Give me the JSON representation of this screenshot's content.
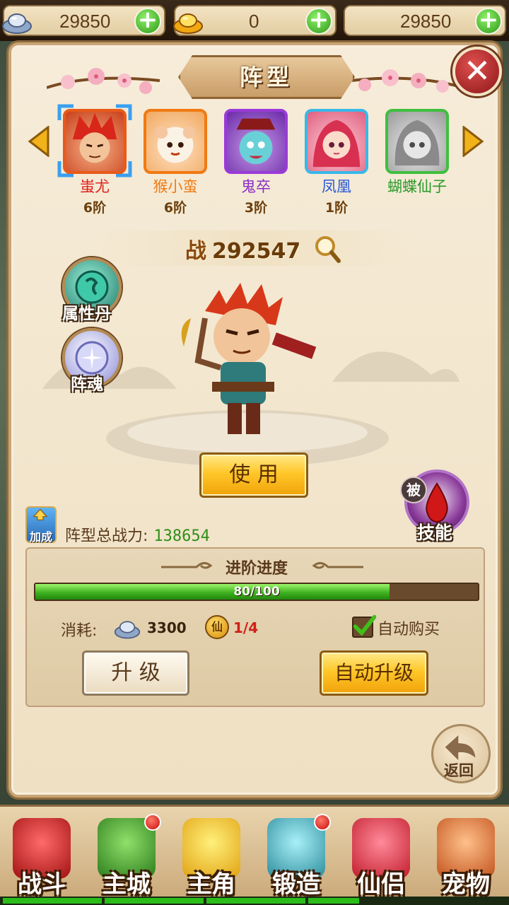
{
  "currency": {
    "silver": "29850",
    "gold": "0",
    "third": "29850",
    "plus": "+"
  },
  "panel": {
    "title": "阵型",
    "close": "✕"
  },
  "heroes": [
    {
      "name": "蚩尤",
      "rank": "6阶",
      "name_color": "#e0201a",
      "frame_color": "#e85a1a",
      "selected": true
    },
    {
      "name": "猴小蛮",
      "rank": "6阶",
      "name_color": "#f07a12",
      "frame_color": "#f07a12",
      "selected": false
    },
    {
      "name": "鬼卒",
      "rank": "3阶",
      "name_color": "#8a2cc8",
      "frame_color": "#9a3ad8",
      "selected": false
    },
    {
      "name": "凤凰",
      "rank": "1阶",
      "name_color": "#2a5ad8",
      "frame_color": "#38b8e8",
      "selected": false
    },
    {
      "name": "蝴蝶仙子",
      "rank": "",
      "name_color": "#2a9a2a",
      "frame_color": "#3fbf3f",
      "selected": false
    }
  ],
  "combat": {
    "label": "战",
    "value": "292547"
  },
  "side_buttons": {
    "attribute_pill": "属性丹",
    "formation_soul": "阵魂"
  },
  "use_button": "使 用",
  "skill": {
    "passive_tag": "被",
    "label": "技能"
  },
  "bonus_label": "加成",
  "total_power": {
    "label": "阵型总战力:",
    "value": "138654"
  },
  "advance": {
    "title": "进阶进度",
    "progress_text": "80/100",
    "current": 80,
    "max": 100,
    "cost_label": "消耗:",
    "silver_cost": "3300",
    "token_glyph": "仙",
    "token_cost": "1/4",
    "auto_buy_label": "自动购买",
    "auto_buy_checked": true,
    "upgrade_button": "升 级",
    "auto_upgrade_button": "自动升级"
  },
  "back_label": "返回",
  "nav": [
    {
      "label": "战斗",
      "badge": false,
      "color": "#d8262a"
    },
    {
      "label": "主城",
      "badge": true,
      "color": "#3f9a2a"
    },
    {
      "label": "主角",
      "badge": false,
      "color": "#f2b81a"
    },
    {
      "label": "锻造",
      "badge": true,
      "color": "#3aa8b8"
    },
    {
      "label": "仙侣",
      "badge": false,
      "color": "#e2323a"
    },
    {
      "label": "宠物",
      "badge": false,
      "color": "#e0641a"
    }
  ],
  "colors": {
    "accent_gold": "#ffc729",
    "progress_green": "#3fb321",
    "power_value": "#2f8f1a"
  }
}
